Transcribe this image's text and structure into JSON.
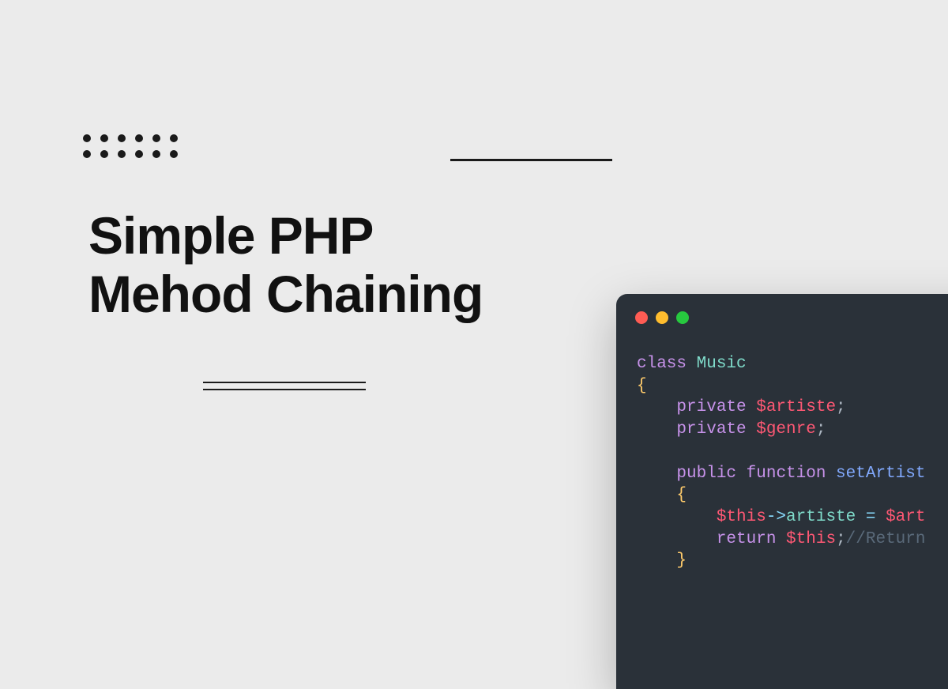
{
  "heading_line1": "Simple PHP",
  "heading_line2": "Mehod Chaining",
  "code": {
    "l1_kw": "class",
    "l1_name": " Music",
    "l2": "{",
    "l3_kw": "    private",
    "l3_var": " $artiste",
    "l3_end": ";",
    "l4_kw": "    private",
    "l4_var": " $genre",
    "l4_end": ";",
    "l6_kw": "    public",
    "l6_kw2": " function",
    "l6_name": " setArtist",
    "l7": "    {",
    "l8_var": "        $this",
    "l8_arrow": "->",
    "l8_prop": "artiste",
    "l8_op": " = ",
    "l8_var2": "$art",
    "l9_kw": "        return",
    "l9_var": " $this",
    "l9_end": ";",
    "l9_comment": "//Return",
    "l10": "    }"
  }
}
